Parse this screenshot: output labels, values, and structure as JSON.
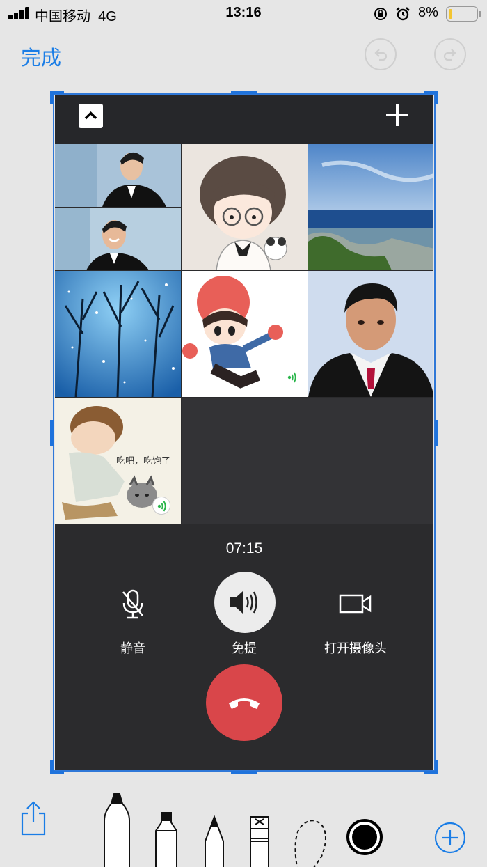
{
  "status_bar": {
    "carrier": "中国移动",
    "network": "4G",
    "time": "13:16",
    "battery_percent": "8%",
    "battery_level": 0.08
  },
  "toolbar": {
    "done_label": "完成",
    "undo_icon": "undo-icon",
    "redo_icon": "redo-icon"
  },
  "call": {
    "timer": "07:15",
    "controls": {
      "mute_label": "静音",
      "speaker_label": "免提",
      "camera_label": "打开摄像头"
    },
    "participants": [
      {
        "avatar": "man-in-suit-photo",
        "speaking": false
      },
      {
        "avatar": "cartoon-boy-glasses",
        "speaking": false
      },
      {
        "avatar": "seaside-landscape",
        "speaking": false
      },
      {
        "avatar": "starry-trees",
        "speaking": false
      },
      {
        "avatar": "cartoon-girl-red-hat",
        "speaking": true
      },
      {
        "avatar": "man-portrait-photo",
        "speaking": false
      },
      {
        "avatar": "baby-with-cat-sticker",
        "speaking": true,
        "caption": "吃吧，吃饱了"
      }
    ]
  },
  "markup_tools": [
    "pen",
    "marker",
    "pencil",
    "eraser",
    "lasso",
    "color-picker",
    "add"
  ],
  "colors": {
    "accent": "#1a7de6",
    "crop_frame": "#2f78d8",
    "hangup": "#d9464a",
    "call_background": "#2b2b2d"
  }
}
